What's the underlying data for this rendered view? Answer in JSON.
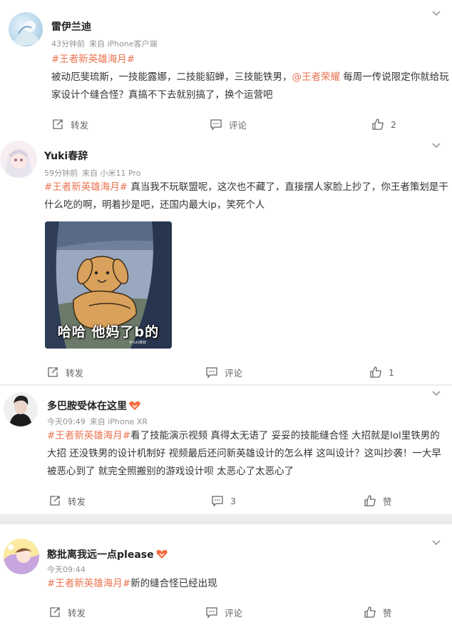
{
  "posts": [
    {
      "username": "雷伊兰迪",
      "time": "43分钟前",
      "source": "来自 iPhone客户端",
      "content": [
        {
          "t": "tag",
          "v": "#王者新英雄海月#"
        },
        {
          "t": "text",
          "v": "被动厄斐琉斯，一技能露娜，二技能貂蝉，三技能铁男，"
        },
        {
          "t": "mention",
          "v": "@王者荣耀"
        },
        {
          "t": "text",
          "v": " 每周一传说限定你就给玩家设计个缝合怪？真搞不下去就别搞了，换个运营吧"
        }
      ],
      "actions": {
        "repost": "转发",
        "comment": "评论",
        "like_count": "2"
      }
    },
    {
      "username": "Yuki春辞",
      "time": "59分钟前",
      "source": "来自 小米11 Pro",
      "content": [
        {
          "t": "tag",
          "v": "#王者新英雄海月#"
        },
        {
          "t": "text",
          "v": " 真当我不玩联盟呢，这次也不藏了，直接摆人家脸上抄了，你王者策划是干什么吃的啊，明着抄是吧，还国内最大ip，笑死个人"
        }
      ],
      "image": {
        "caption": "哈哈 他妈了b的",
        "watermark": "#Yuki春辞"
      },
      "actions": {
        "repost": "转发",
        "comment": "评论",
        "like_count": "1"
      }
    },
    {
      "username": "多巴胺受体在这里",
      "time": "今天09:49",
      "source": "来自 iPhone XR",
      "content": [
        {
          "t": "tag",
          "v": "#王者新英雄海月#"
        },
        {
          "t": "text",
          "v": "看了技能演示视频 真得太无语了 妥妥的技能缝合怪 大招就是lol里铁男的大招 还没铁男的设计机制好 视频最后还问新英雄设计的怎么样 这叫设计？这叫抄袭！一大早被恶心到了 就完全照搬别的游戏设计呗 太恶心了太恶心了"
        }
      ],
      "actions": {
        "repost": "转发",
        "comment_count": "3",
        "like": "赞"
      }
    },
    {
      "username": "憨批离我远一点please",
      "time": "今天09:44",
      "source": "",
      "content": [
        {
          "t": "tag",
          "v": "#王者新英雄海月#"
        },
        {
          "t": "text",
          "v": "新的缝合怪已经出现"
        }
      ],
      "actions": {
        "repost": "转发",
        "comment": "评论",
        "like": "赞"
      }
    }
  ],
  "colors": {
    "tag": "#eb7350",
    "username": "#222222",
    "meta": "#939393",
    "background": "#ececec"
  },
  "icons": [
    "repost-icon",
    "comment-icon",
    "like-icon",
    "chevron-down-icon",
    "vip-badge-icon"
  ]
}
